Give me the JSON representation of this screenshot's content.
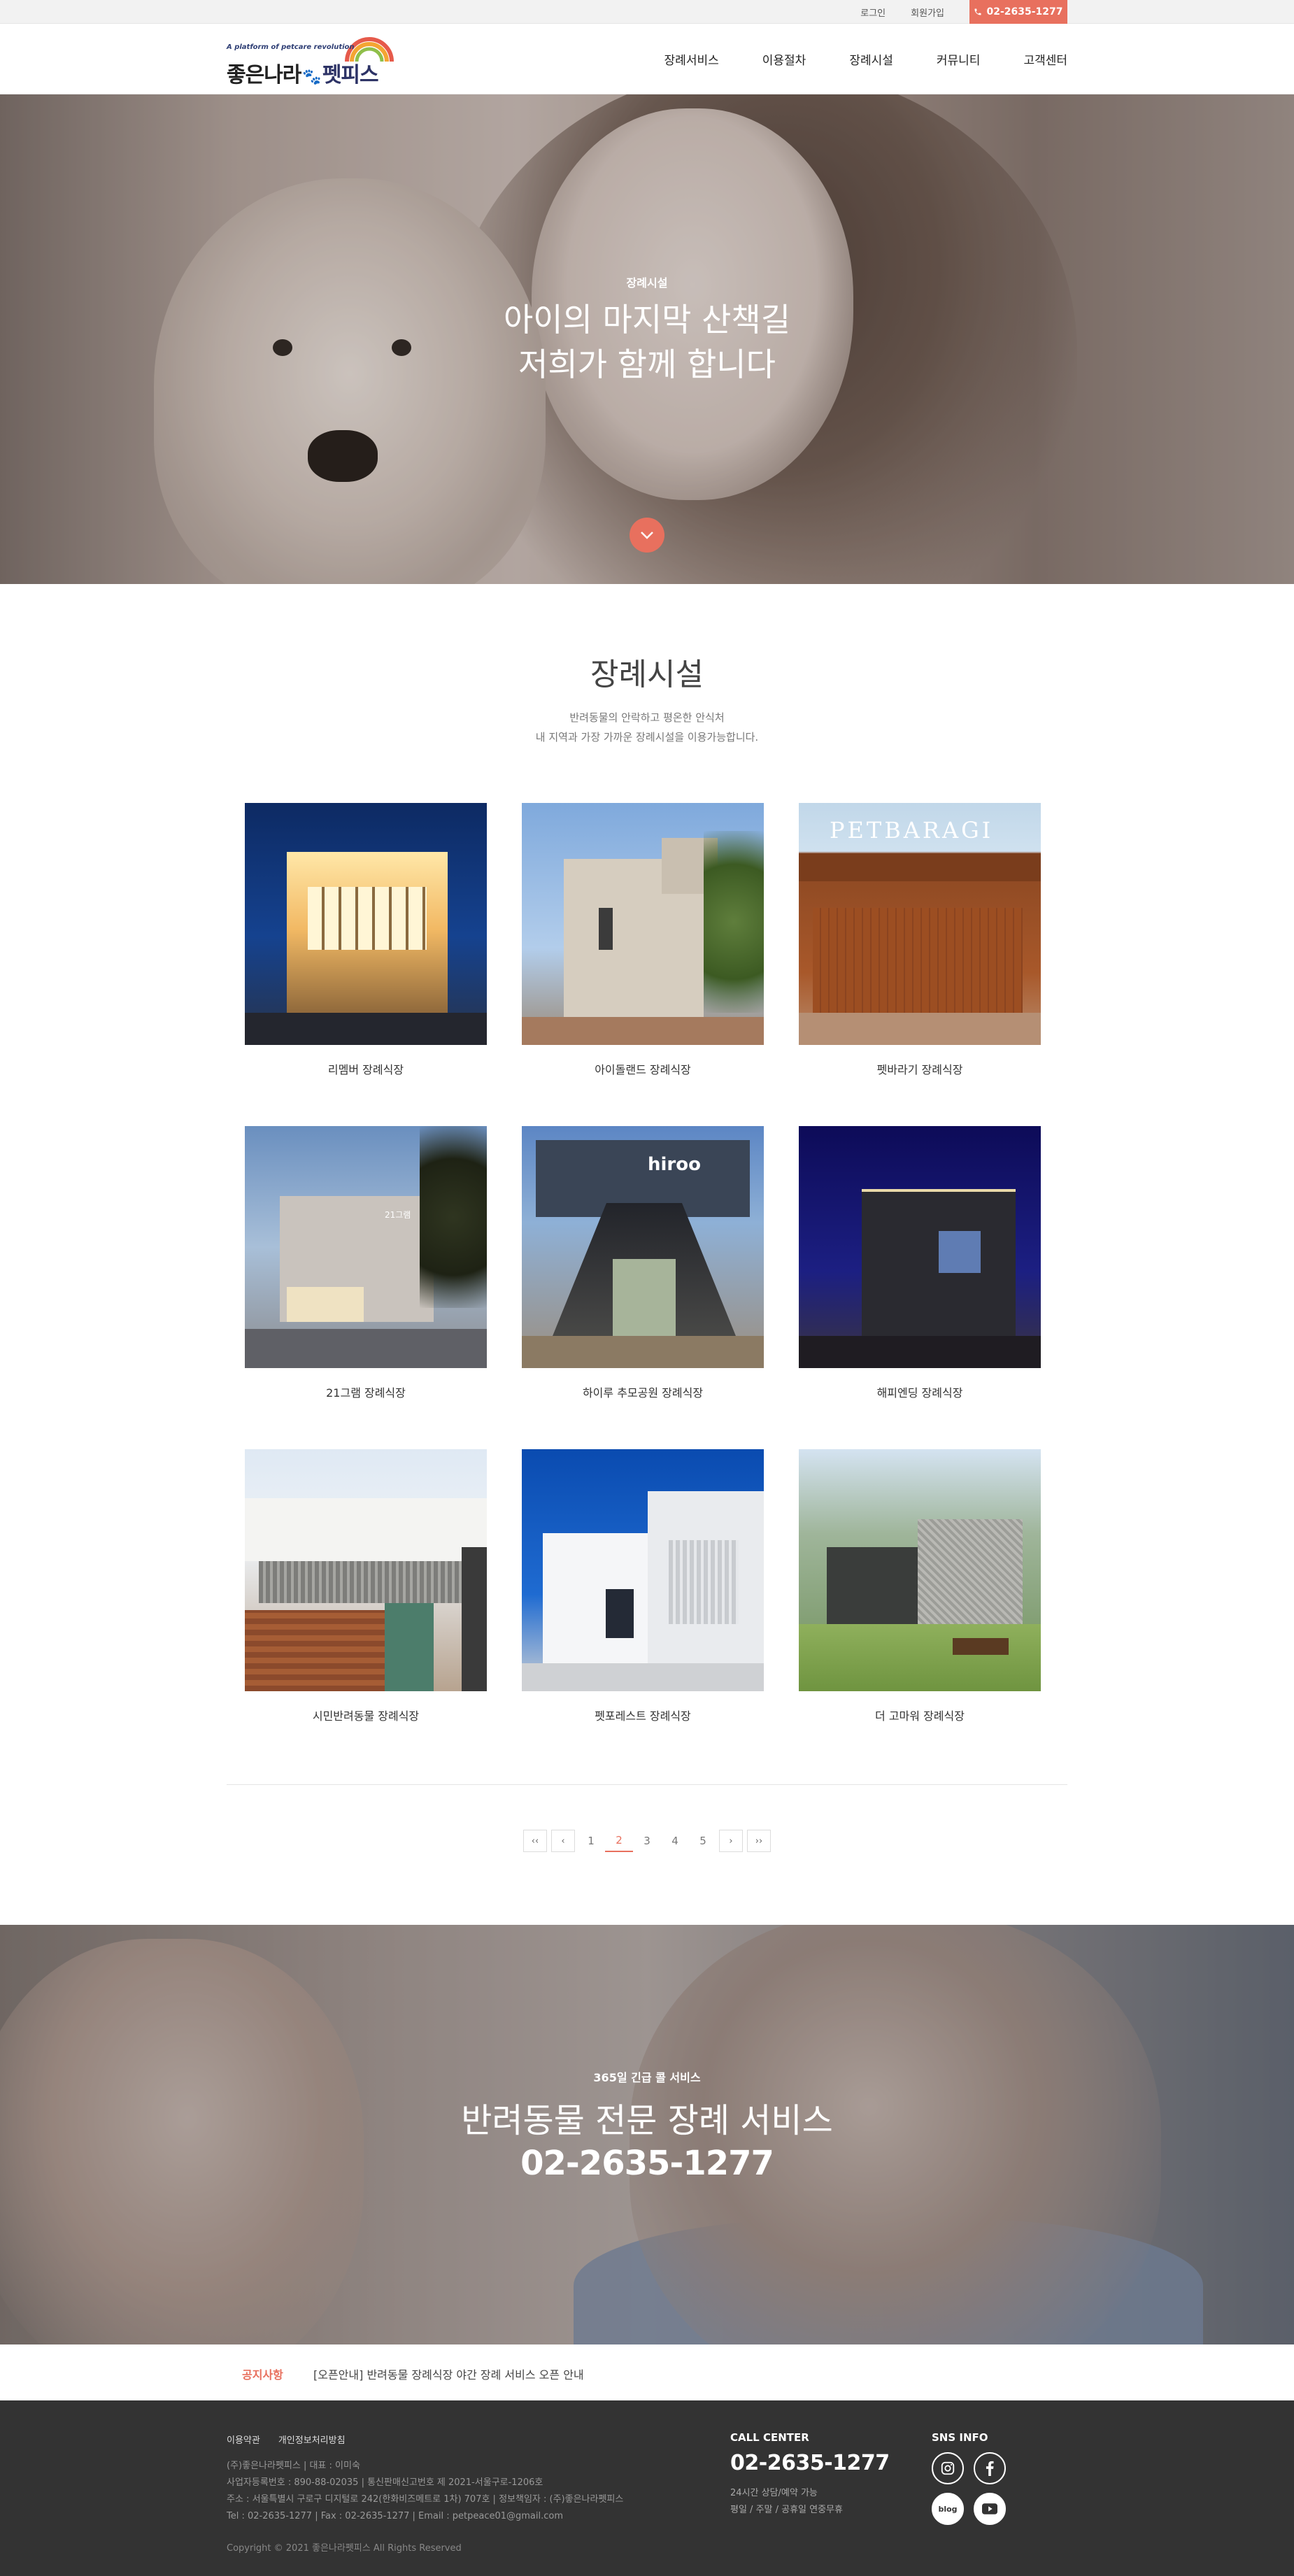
{
  "topbar": {
    "login": "로그인",
    "signup": "회원가입",
    "phone": "02-2635-1277"
  },
  "logo": {
    "tagline": "A platform of petcare revolution",
    "name_part1": "좋은나라",
    "name_part2": "펫피스"
  },
  "nav": [
    "장례서비스",
    "이용절차",
    "장례시설",
    "커뮤니티",
    "고객센터"
  ],
  "hero": {
    "sub": "장례시설",
    "title_line1": "아이의 마지막 산책길",
    "title_line2": "저희가 함께 합니다"
  },
  "section": {
    "title": "장례시설",
    "desc_line1": "반려동물의 안락하고 평온한 안식처",
    "desc_line2": "내 지역과 가장 가까운 장례시설을 이용가능합니다."
  },
  "facilities": [
    {
      "name": "리멤버 장례식장"
    },
    {
      "name": "아이돌랜드 장례식장"
    },
    {
      "name": "펫바라기 장례식장"
    },
    {
      "name": "21그램 장례식장"
    },
    {
      "name": "하이루 추모공원 장례식장"
    },
    {
      "name": "해피엔딩 장례식장"
    },
    {
      "name": "시민반려동물 장례식장"
    },
    {
      "name": "펫포레스트 장례식장"
    },
    {
      "name": "더 고마워 장례식장"
    }
  ],
  "facility_signs": {
    "petbaragi": "PETBARAGI",
    "gram21": "21그램",
    "hiroo": "hiroo"
  },
  "pagination": {
    "first": "‹‹",
    "prev": "‹",
    "pages": [
      "1",
      "2",
      "3",
      "4",
      "5"
    ],
    "current": "2",
    "next": "›",
    "last": "››"
  },
  "call": {
    "sub": "365일 긴급 콜 서비스",
    "title": "반려동물 전문 장례 서비스",
    "phone": "02-2635-1277"
  },
  "notice": {
    "tag": "공지사항",
    "text": "[오픈안내] 반려동물 장례식장 야간 장례 서비스 오픈 안내"
  },
  "footer": {
    "links": [
      "이용약관",
      "개인정보처리방침"
    ],
    "company": "(주)좋은나라펫피스 | 대표 : 이미숙",
    "biz": "사업자등록번호 : 890-88-02035 | 통신판매신고번호 제 2021-서울구로-1206호",
    "address": "주소 : 서울특별시 구로구 디지털로 242(한화비즈메트로 1차) 707호 | 정보책임자 : (주)좋은나라펫피스",
    "contact": "Tel : 02-2635-1277 | Fax : 02-2635-1277 | Email : petpeace01@gmail.com",
    "copyright": "Copyright © 2021 좋은나라펫피스 All Rights Reserved",
    "callcenter_title": "CALL CENTER",
    "callcenter_phone": "02-2635-1277",
    "hours_line1": "24시간 상담/예약 가능",
    "hours_line2": "평일 / 주말 / 공휴일 연중무휴",
    "sns_title": "SNS INFO",
    "sns_icons": [
      "instagram-icon",
      "facebook-icon",
      "blog-icon",
      "youtube-icon"
    ],
    "blog_text": "blog"
  },
  "colors": {
    "accent": "#e8705e",
    "footer_bg": "#333333",
    "topbar_bg": "#f2f2f2"
  }
}
